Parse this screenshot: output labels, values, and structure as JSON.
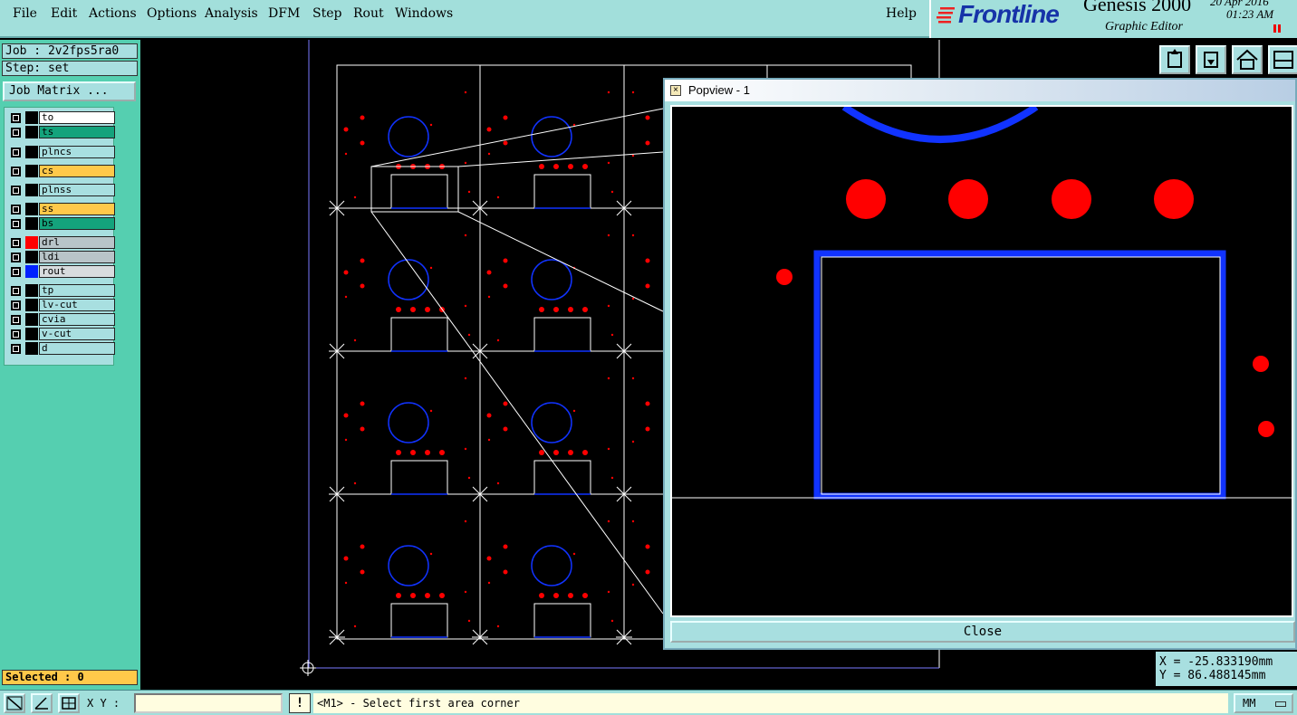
{
  "menu": {
    "file": "File",
    "edit": "Edit",
    "actions": "Actions",
    "options": "Options",
    "analysis": "Analysis",
    "dfm": "DFM",
    "step": "Step",
    "rout": "Rout",
    "windows": "Windows",
    "help": "Help"
  },
  "brand": {
    "logo": "Frontline",
    "product": "Genesis 2000",
    "subtitle": "Graphic Editor",
    "date": "20 Apr 2016",
    "time": "01:23 AM"
  },
  "job": {
    "job_label": "Job : 2v2fps5ra0",
    "step_label": "Step: set",
    "matrix_button": "Job Matrix ..."
  },
  "layers": [
    {
      "name": "to",
      "bg": "#ffffff",
      "swatch": "#000000"
    },
    {
      "name": "ts",
      "bg": "#14a37c",
      "swatch": "#000000"
    },
    {
      "name": "plncs",
      "bg": "#a8dfe0",
      "swatch": "#000000"
    },
    {
      "name": "cs",
      "bg": "#ffc94a",
      "swatch": "#000000"
    },
    {
      "name": "plnss",
      "bg": "#a8dfe0",
      "swatch": "#000000"
    },
    {
      "name": "ss",
      "bg": "#ffc94a",
      "swatch": "#000000"
    },
    {
      "name": "bs",
      "bg": "#14a37c",
      "swatch": "#000000"
    },
    {
      "name": "drl",
      "bg": "#b8c4c8",
      "swatch": "#ff0000"
    },
    {
      "name": "ldi",
      "bg": "#b8c4c8",
      "swatch": "#000000"
    },
    {
      "name": "rout",
      "bg": "#d8dcde",
      "swatch": "#0022ff"
    },
    {
      "name": "tp",
      "bg": "#a8dfe0",
      "swatch": "#000000"
    },
    {
      "name": "lv-cut",
      "bg": "#a8dfe0",
      "swatch": "#000000"
    },
    {
      "name": "cvia",
      "bg": "#a8dfe0",
      "swatch": "#000000"
    },
    {
      "name": "v-cut",
      "bg": "#a8dfe0",
      "swatch": "#000000"
    },
    {
      "name": "d",
      "bg": "#a8dfe0",
      "swatch": "#000000"
    }
  ],
  "selected": "Selected : 0",
  "popview": {
    "title": "Popview - 1",
    "close": "Close"
  },
  "coords": {
    "x": "X = -25.833190mm",
    "y": "Y = 86.488145mm"
  },
  "bottom": {
    "xy_label": "X Y :",
    "xy_value": "",
    "message_indicator": "!",
    "prompt": "<M1> - Select first area corner",
    "units": "MM"
  },
  "colors": {
    "pad": "#ff0000",
    "rout": "#1133ff",
    "profile": "#ffffff"
  }
}
